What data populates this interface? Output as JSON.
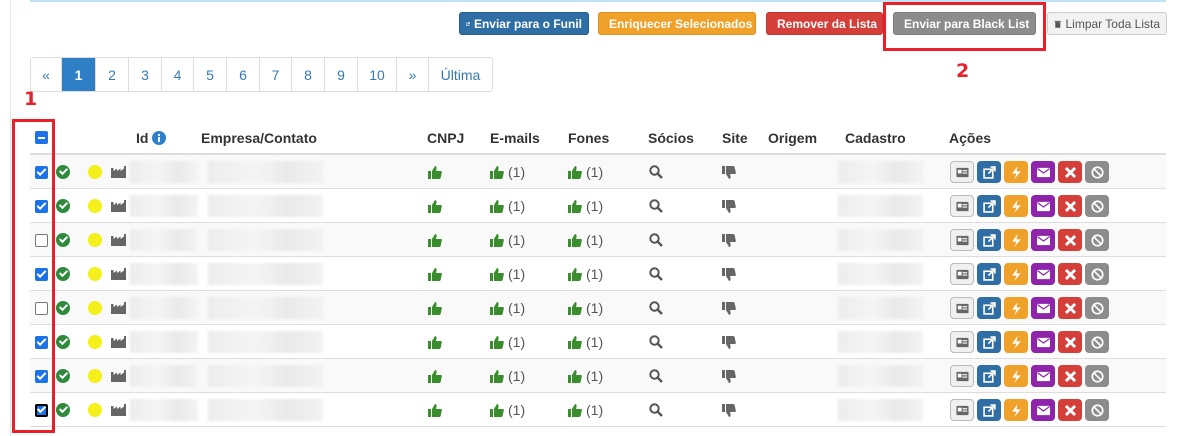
{
  "toolbar": {
    "funil_label": "Enviar para o Funil",
    "enriquecer_label": "Enriquecer Selecionados",
    "remover_label": "Remover da Lista",
    "black_list_label": "Enviar para Black List",
    "limpar_label": "Limpar Toda Lista"
  },
  "annotations": {
    "label_1": "1",
    "label_2": "2"
  },
  "pagination": {
    "prev": "«",
    "pages": [
      "1",
      "2",
      "3",
      "4",
      "5",
      "6",
      "7",
      "8",
      "9",
      "10"
    ],
    "next": "»",
    "last": "Última",
    "active": "1"
  },
  "table": {
    "headers": {
      "id": "Id",
      "empresa": "Empresa/Contato",
      "cnpj": "CNPJ",
      "emails": "E-mails",
      "fones": "Fones",
      "socios": "Sócios",
      "site": "Site",
      "origem": "Origem",
      "cadastro": "Cadastro",
      "acoes": "Ações"
    },
    "rows": [
      {
        "checked": true,
        "emails": "(1)",
        "fones": "(1)"
      },
      {
        "checked": true,
        "emails": "(1)",
        "fones": "(1)"
      },
      {
        "checked": false,
        "emails": "(1)",
        "fones": "(1)"
      },
      {
        "checked": true,
        "emails": "(1)",
        "fones": "(1)"
      },
      {
        "checked": false,
        "emails": "(1)",
        "fones": "(1)"
      },
      {
        "checked": true,
        "emails": "(1)",
        "fones": "(1)"
      },
      {
        "checked": true,
        "emails": "(1)",
        "fones": "(1)"
      },
      {
        "checked": true,
        "emails": "(1)",
        "fones": "(1)"
      }
    ]
  },
  "colors": {
    "primary": "#2f6ea5",
    "warning": "#f0a129",
    "danger": "#d43f3a",
    "muted": "#8c8c8c",
    "success": "#2e8b3b",
    "purple": "#8e24aa",
    "annotation_red": "#e8202a"
  },
  "icons": [
    "share-icon",
    "bolt-icon",
    "times-icon",
    "ban-icon",
    "trash-icon",
    "info-icon",
    "thumbs-up-icon",
    "thumbs-down-icon",
    "search-icon",
    "factory-icon",
    "check-circle-icon",
    "id-card-icon",
    "envelope-icon"
  ]
}
